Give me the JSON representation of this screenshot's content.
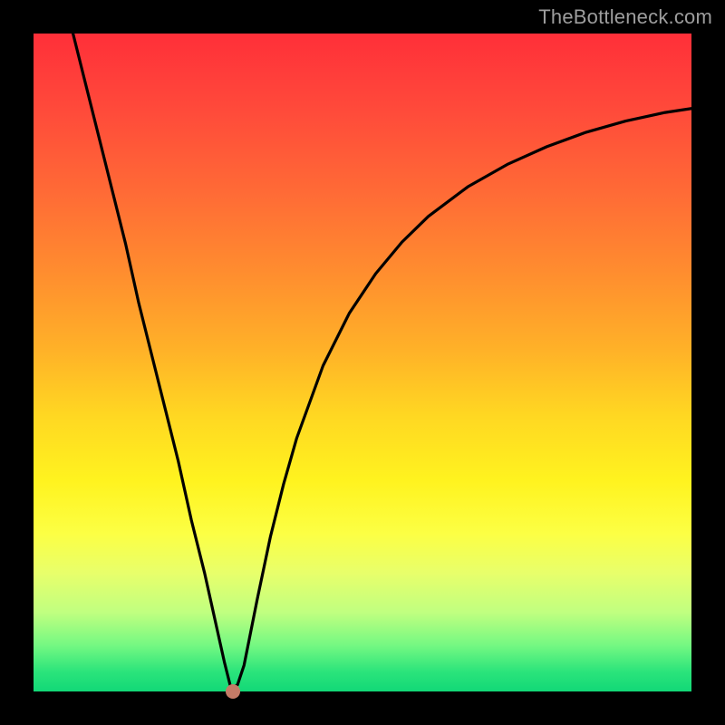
{
  "watermark": {
    "text": "TheBottleneck.com"
  },
  "colors": {
    "page_background": "#000000",
    "curve_stroke": "#000000",
    "marker_fill": "#c57b67",
    "watermark_text": "#9d9d9d",
    "gradient_top": "#ff2f39",
    "gradient_bottom": "#12d877"
  },
  "chart_data": {
    "type": "line",
    "title": "",
    "xlabel": "",
    "ylabel": "",
    "xlim": [
      0,
      100
    ],
    "ylim": [
      0,
      100
    ],
    "grid": false,
    "legend": false,
    "marker": {
      "x": 30.3,
      "y": 0
    },
    "series": [
      {
        "name": "curve",
        "x": [
          6,
          8,
          10,
          12,
          14,
          16,
          18,
          20,
          22,
          24,
          26,
          27,
          28,
          29,
          30,
          31,
          32,
          33,
          34,
          36,
          38,
          40,
          44,
          48,
          52,
          56,
          60,
          66,
          72,
          78,
          84,
          90,
          96,
          100
        ],
        "y": [
          100,
          92,
          84,
          76,
          68,
          59,
          51,
          43,
          35,
          26,
          18,
          13.5,
          9,
          4.5,
          0.5,
          1,
          4,
          9,
          14,
          23.5,
          31.5,
          38.5,
          49.5,
          57.5,
          63.5,
          68.3,
          72.2,
          76.7,
          80.1,
          82.8,
          85.0,
          86.7,
          88.0,
          88.6
        ]
      }
    ]
  }
}
